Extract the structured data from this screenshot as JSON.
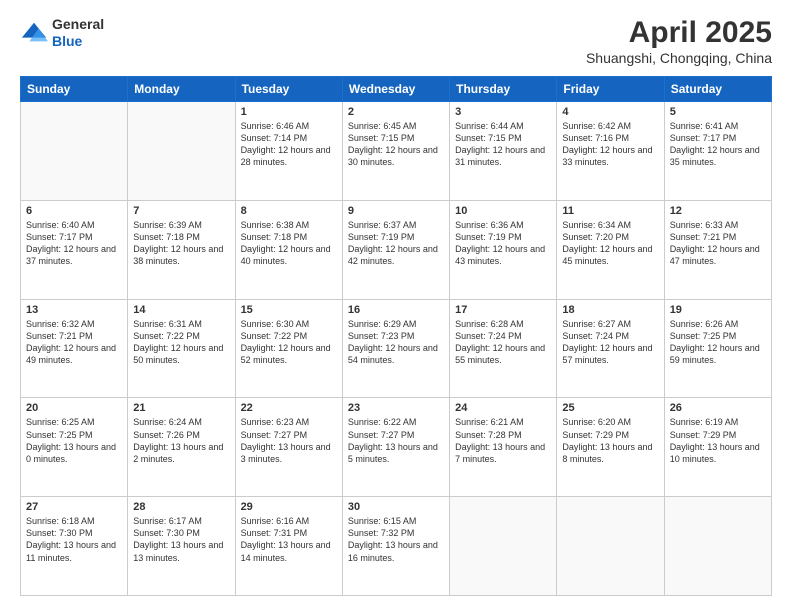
{
  "header": {
    "logo": {
      "general": "General",
      "blue": "Blue"
    },
    "title": "April 2025",
    "subtitle": "Shuangshi, Chongqing, China"
  },
  "calendar": {
    "days_of_week": [
      "Sunday",
      "Monday",
      "Tuesday",
      "Wednesday",
      "Thursday",
      "Friday",
      "Saturday"
    ],
    "weeks": [
      [
        {
          "day": "",
          "sunrise": "",
          "sunset": "",
          "daylight": ""
        },
        {
          "day": "",
          "sunrise": "",
          "sunset": "",
          "daylight": ""
        },
        {
          "day": "1",
          "sunrise": "Sunrise: 6:46 AM",
          "sunset": "Sunset: 7:14 PM",
          "daylight": "Daylight: 12 hours and 28 minutes."
        },
        {
          "day": "2",
          "sunrise": "Sunrise: 6:45 AM",
          "sunset": "Sunset: 7:15 PM",
          "daylight": "Daylight: 12 hours and 30 minutes."
        },
        {
          "day": "3",
          "sunrise": "Sunrise: 6:44 AM",
          "sunset": "Sunset: 7:15 PM",
          "daylight": "Daylight: 12 hours and 31 minutes."
        },
        {
          "day": "4",
          "sunrise": "Sunrise: 6:42 AM",
          "sunset": "Sunset: 7:16 PM",
          "daylight": "Daylight: 12 hours and 33 minutes."
        },
        {
          "day": "5",
          "sunrise": "Sunrise: 6:41 AM",
          "sunset": "Sunset: 7:17 PM",
          "daylight": "Daylight: 12 hours and 35 minutes."
        }
      ],
      [
        {
          "day": "6",
          "sunrise": "Sunrise: 6:40 AM",
          "sunset": "Sunset: 7:17 PM",
          "daylight": "Daylight: 12 hours and 37 minutes."
        },
        {
          "day": "7",
          "sunrise": "Sunrise: 6:39 AM",
          "sunset": "Sunset: 7:18 PM",
          "daylight": "Daylight: 12 hours and 38 minutes."
        },
        {
          "day": "8",
          "sunrise": "Sunrise: 6:38 AM",
          "sunset": "Sunset: 7:18 PM",
          "daylight": "Daylight: 12 hours and 40 minutes."
        },
        {
          "day": "9",
          "sunrise": "Sunrise: 6:37 AM",
          "sunset": "Sunset: 7:19 PM",
          "daylight": "Daylight: 12 hours and 42 minutes."
        },
        {
          "day": "10",
          "sunrise": "Sunrise: 6:36 AM",
          "sunset": "Sunset: 7:19 PM",
          "daylight": "Daylight: 12 hours and 43 minutes."
        },
        {
          "day": "11",
          "sunrise": "Sunrise: 6:34 AM",
          "sunset": "Sunset: 7:20 PM",
          "daylight": "Daylight: 12 hours and 45 minutes."
        },
        {
          "day": "12",
          "sunrise": "Sunrise: 6:33 AM",
          "sunset": "Sunset: 7:21 PM",
          "daylight": "Daylight: 12 hours and 47 minutes."
        }
      ],
      [
        {
          "day": "13",
          "sunrise": "Sunrise: 6:32 AM",
          "sunset": "Sunset: 7:21 PM",
          "daylight": "Daylight: 12 hours and 49 minutes."
        },
        {
          "day": "14",
          "sunrise": "Sunrise: 6:31 AM",
          "sunset": "Sunset: 7:22 PM",
          "daylight": "Daylight: 12 hours and 50 minutes."
        },
        {
          "day": "15",
          "sunrise": "Sunrise: 6:30 AM",
          "sunset": "Sunset: 7:22 PM",
          "daylight": "Daylight: 12 hours and 52 minutes."
        },
        {
          "day": "16",
          "sunrise": "Sunrise: 6:29 AM",
          "sunset": "Sunset: 7:23 PM",
          "daylight": "Daylight: 12 hours and 54 minutes."
        },
        {
          "day": "17",
          "sunrise": "Sunrise: 6:28 AM",
          "sunset": "Sunset: 7:24 PM",
          "daylight": "Daylight: 12 hours and 55 minutes."
        },
        {
          "day": "18",
          "sunrise": "Sunrise: 6:27 AM",
          "sunset": "Sunset: 7:24 PM",
          "daylight": "Daylight: 12 hours and 57 minutes."
        },
        {
          "day": "19",
          "sunrise": "Sunrise: 6:26 AM",
          "sunset": "Sunset: 7:25 PM",
          "daylight": "Daylight: 12 hours and 59 minutes."
        }
      ],
      [
        {
          "day": "20",
          "sunrise": "Sunrise: 6:25 AM",
          "sunset": "Sunset: 7:25 PM",
          "daylight": "Daylight: 13 hours and 0 minutes."
        },
        {
          "day": "21",
          "sunrise": "Sunrise: 6:24 AM",
          "sunset": "Sunset: 7:26 PM",
          "daylight": "Daylight: 13 hours and 2 minutes."
        },
        {
          "day": "22",
          "sunrise": "Sunrise: 6:23 AM",
          "sunset": "Sunset: 7:27 PM",
          "daylight": "Daylight: 13 hours and 3 minutes."
        },
        {
          "day": "23",
          "sunrise": "Sunrise: 6:22 AM",
          "sunset": "Sunset: 7:27 PM",
          "daylight": "Daylight: 13 hours and 5 minutes."
        },
        {
          "day": "24",
          "sunrise": "Sunrise: 6:21 AM",
          "sunset": "Sunset: 7:28 PM",
          "daylight": "Daylight: 13 hours and 7 minutes."
        },
        {
          "day": "25",
          "sunrise": "Sunrise: 6:20 AM",
          "sunset": "Sunset: 7:29 PM",
          "daylight": "Daylight: 13 hours and 8 minutes."
        },
        {
          "day": "26",
          "sunrise": "Sunrise: 6:19 AM",
          "sunset": "Sunset: 7:29 PM",
          "daylight": "Daylight: 13 hours and 10 minutes."
        }
      ],
      [
        {
          "day": "27",
          "sunrise": "Sunrise: 6:18 AM",
          "sunset": "Sunset: 7:30 PM",
          "daylight": "Daylight: 13 hours and 11 minutes."
        },
        {
          "day": "28",
          "sunrise": "Sunrise: 6:17 AM",
          "sunset": "Sunset: 7:30 PM",
          "daylight": "Daylight: 13 hours and 13 minutes."
        },
        {
          "day": "29",
          "sunrise": "Sunrise: 6:16 AM",
          "sunset": "Sunset: 7:31 PM",
          "daylight": "Daylight: 13 hours and 14 minutes."
        },
        {
          "day": "30",
          "sunrise": "Sunrise: 6:15 AM",
          "sunset": "Sunset: 7:32 PM",
          "daylight": "Daylight: 13 hours and 16 minutes."
        },
        {
          "day": "",
          "sunrise": "",
          "sunset": "",
          "daylight": ""
        },
        {
          "day": "",
          "sunrise": "",
          "sunset": "",
          "daylight": ""
        },
        {
          "day": "",
          "sunrise": "",
          "sunset": "",
          "daylight": ""
        }
      ]
    ]
  }
}
